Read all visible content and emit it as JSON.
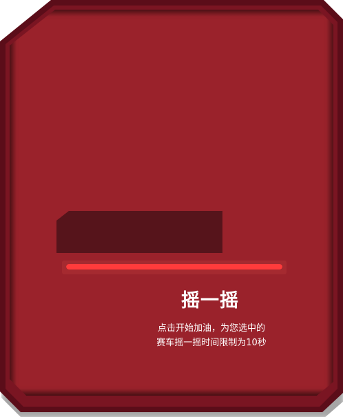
{
  "panel": {
    "title": "摇一摇",
    "description_lines": [
      "点击开始加油，为您选中的",
      "赛车摇一摇时间限制为10秒"
    ],
    "progress_fraction": 1.0
  },
  "colors": {
    "frame_outer": "#5b0d19",
    "frame_mid": "#7a1522",
    "panel_bg": "#9a222b",
    "plate_bg": "#56141b",
    "progress_fill": "#ff3b3b",
    "text": "#ffffff"
  }
}
